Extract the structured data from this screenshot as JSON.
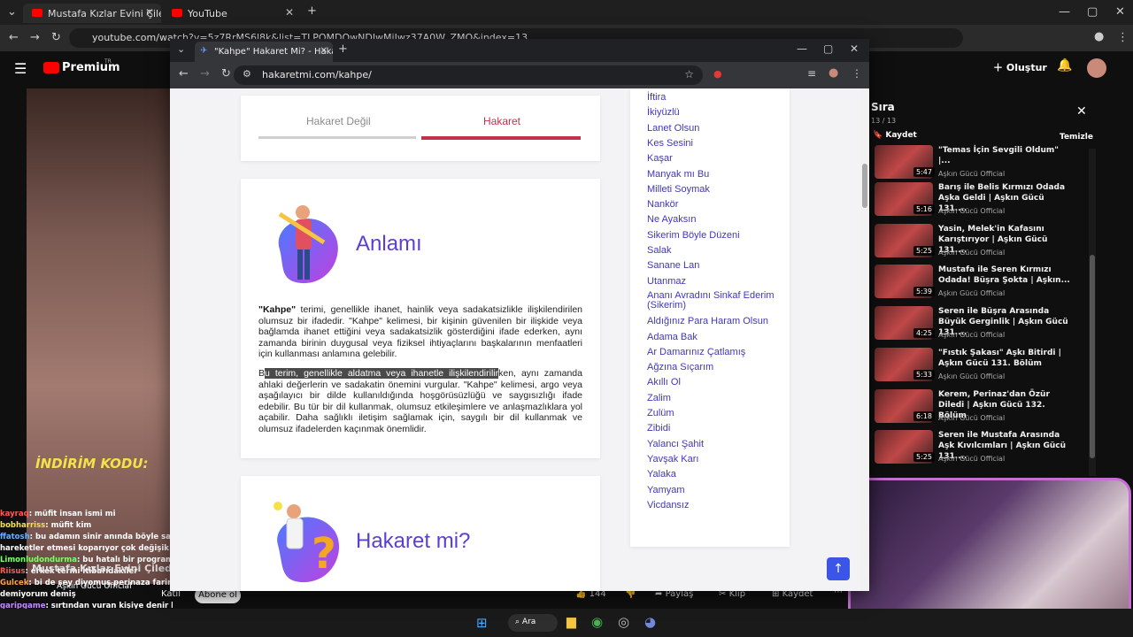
{
  "back_browser": {
    "tabs": [
      {
        "title": "Mustafa Kızlar Evini Çileden Çık"
      },
      {
        "title": "YouTube"
      }
    ],
    "url": "youtube.com/watch?v=5z7RrMS6l8k&list=TLPQMDQwNDIwMjIwz37A0W_ZMQ&index=13"
  },
  "youtube": {
    "logo": "Premium",
    "logo_sup": "TR",
    "create_label": "Oluştur",
    "queue": {
      "title": "Sıra",
      "count": "13 / 13",
      "save_label": "Kaydet",
      "clear_label": "Temizle",
      "items": [
        {
          "title": "\"Temas İçin Sevgili Oldum\" |...",
          "channel": "Aşkın Gücü Official",
          "duration": "5:47"
        },
        {
          "title": "Barış ile Belis Kırmızı Odada Aşka Geldi | Aşkın Gücü 131....",
          "channel": "Aşkın Gücü Official",
          "duration": "5:16"
        },
        {
          "title": "Yasin, Melek'in Kafasını Karıştırıyor | Aşkın Gücü 131....",
          "channel": "Aşkın Gücü Official",
          "duration": "5:25"
        },
        {
          "title": "Mustafa ile Seren Kırmızı Odada! Büşra Şokta | Aşkın...",
          "channel": "Aşkın Gücü Official",
          "duration": "5:39"
        },
        {
          "title": "Seren ile Büşra Arasında Büyük Gerginlik | Aşkın Gücü 131....",
          "channel": "Aşkın Gücü Official",
          "duration": "4:25"
        },
        {
          "title": "\"Fıstık Şakası\" Aşkı Bitirdi | Aşkın Gücü 131. Bölüm",
          "channel": "Aşkın Gücü Official",
          "duration": "5:33"
        },
        {
          "title": "Kerem, Perinaz'dan Özür Diledi | Aşkın Gücü 132. Bölüm",
          "channel": "Aşkın Gücü Official",
          "duration": "6:18"
        },
        {
          "title": "Seren ile Mustafa Arasında Aşk Kıvılcımları | Aşkın Gücü 131....",
          "channel": "Aşkın Gücü Official",
          "duration": "5:25"
        }
      ]
    },
    "actions": {
      "likes": "144",
      "share": "Paylaş",
      "clip": "Klip",
      "save": "Kaydet"
    },
    "channel_row": {
      "join": "Katıl",
      "subscribe": "Abone ol",
      "channel": "Aşkın Gücü Official",
      "video_title": "Mustafa Kızlar Evini Çileden"
    }
  },
  "stream_overlay": {
    "promo": "İNDİRİM KODU:",
    "chat": [
      {
        "user": "kayraq",
        "msg": ": müfit insan ismi mi",
        "color": "#ff5a5a"
      },
      {
        "user": "bobharriss",
        "msg": ": müfit kim",
        "color": "#f5e14a"
      },
      {
        "user": "ffatosh",
        "msg": ": bu adamın sinir anında böyle saçma",
        "color": "#6ab0ff"
      },
      {
        "user": "",
        "msg": "hareketler etmesi koparıyor çok değişik çar",
        "color": "#fff"
      },
      {
        "user": "Limonludondurma",
        "msg": ": bu hatalı bir program olduğu",
        "color": "#7cff6a"
      },
      {
        "user": "Riisus",
        "msg": ": erkek termi itibarıdakiler",
        "color": "#ff5a5a"
      },
      {
        "user": "Gulcek",
        "msg": ": bi de şey diyomuş perinaza farimaha",
        "color": "#ffa04a"
      },
      {
        "user": "",
        "msg": "demiyorum demiş",
        "color": "#fff"
      },
      {
        "user": "garipgame",
        "msg": ": sırtından vuran kişiye denir kısaca",
        "color": "#c78aff"
      }
    ]
  },
  "popup": {
    "tab_title": "\"Kahpe\" Hakaret Mi? - Hakaret",
    "url": "hakaretmi.com/kahpe/",
    "segments": {
      "left": "Hakaret Değil",
      "right": "Hakaret",
      "active": "right"
    },
    "meaning": {
      "title": "Anlamı",
      "para1_bold": "\"Kahpe\"",
      "para1": " terimi, genellikle ihanet, hainlik veya sadakatsizlikle ilişkilendirilen olumsuz bir ifadedir. \"Kahpe\" kelimesi, bir kişinin güvenilen bir ilişkide veya bağlamda ihanet ettiğini veya sadakatsizlik gösterdiğini ifade ederken, aynı zamanda birinin duygusal veya fiziksel ihtiyaçlarını başkalarının menfaatleri için kullanması anlamına gelebilir.",
      "para2_pre": "B",
      "para2_highlight": "u terim, genellikle aldatma veya ihanetle ilişkilendirilir",
      "para2_rest": "ken, aynı zamanda ahlaki değerlerin ve sadakatin önemini vurgular. \"Kahpe\" kelimesi, argo veya aşağılayıcı bir dilde kullanıldığında hoşgörüsüzlüğü ve saygısızlığı ifade edebilir. Bu tür bir dil kullanmak, olumsuz etkileşimlere ve anlaşmazlıklara yol açabilir. Daha sağlıklı iletişim sağlamak için, saygılı bir dil kullanmak ve olumsuz ifadelerden kaçınmak önemlidir."
    },
    "question": {
      "title": "Hakaret mi?"
    },
    "words": [
      "İftira",
      "İkiyüzlü",
      "Lanet Olsun",
      "Kes Sesini",
      "Kaşar",
      "Manyak mı Bu",
      "Milleti Soymak",
      "Nankör",
      "Ne Ayaksın",
      "Sikerim Böyle Düzeni",
      "Salak",
      "Sanane Lan",
      "Utanmaz",
      "Ananı Avradını Sinkaf Ederim (Sikerim)",
      "Aldığınız Para Haram Olsun",
      "Adama Bak",
      "Ar Damarınız Çatlamış",
      "Ağzına Sıçarım",
      "Akıllı Ol",
      "Zalim",
      "Zulüm",
      "Zibidi",
      "Yalancı Şahit",
      "Yavşak Karı",
      "Yalaka",
      "Yamyam",
      "Vicdansız"
    ]
  },
  "taskbar": {
    "search": "Ara"
  },
  "colors": {
    "accent": "#5a3fd0",
    "active_tab": "#c0314a",
    "link": "#3f37b8"
  }
}
